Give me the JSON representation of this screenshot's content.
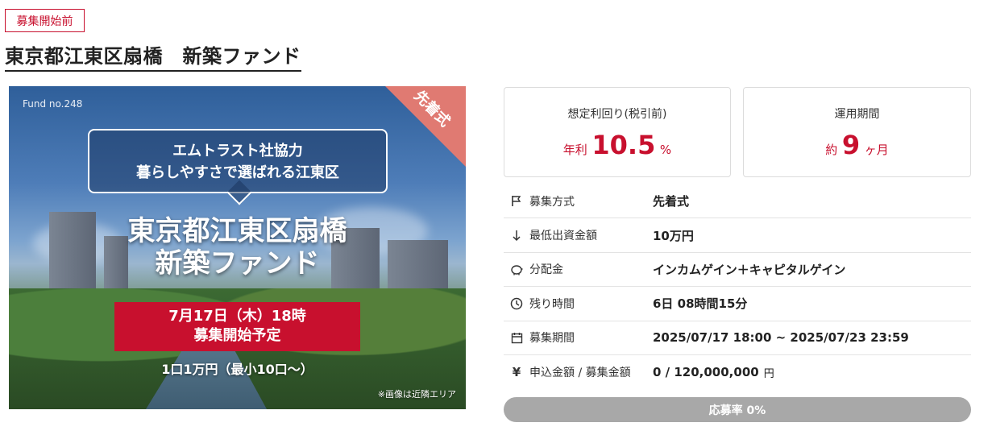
{
  "status_badge": "募集開始前",
  "page_title": "東京都江東区扇橋　新築ファンド",
  "hero": {
    "fund_no": "Fund no.248",
    "corner_tag": "先着式",
    "callout_line1": "エムトラスト社協力",
    "callout_line2": "暮らしやすさで選ばれる江東区",
    "title_line1": "東京都江東区扇橋",
    "title_line2": "新築ファンド",
    "date_line": "7月17日（木）18時",
    "start_line": "募集開始予定",
    "units_line": "1口1万円（最小10口〜）",
    "note": "※画像は近隣エリア"
  },
  "yield_card": {
    "label": "想定利回り(税引前)",
    "prefix": "年利",
    "value": "10.5",
    "suffix": "%"
  },
  "period_card": {
    "label": "運用期間",
    "prefix": "約",
    "value": "9",
    "suffix": "ヶ月"
  },
  "info_rows": [
    {
      "icon": "flag-icon",
      "label": "募集方式",
      "value": "先着式",
      "unit": ""
    },
    {
      "icon": "arrow-down-icon",
      "label": "最低出資金額",
      "value": "10万円",
      "unit": ""
    },
    {
      "icon": "piggy-bank-icon",
      "label": "分配金",
      "value": "インカムゲイン＋キャピタルゲイン",
      "unit": ""
    },
    {
      "icon": "clock-icon",
      "label": "残り時間",
      "value": "6日 08時間15分",
      "unit": ""
    },
    {
      "icon": "calendar-icon",
      "label": "募集期間",
      "value": "2025/07/17 18:00 ~ 2025/07/23 23:59",
      "unit": ""
    },
    {
      "icon": "yen-icon",
      "label": "申込金額 / 募集金額",
      "value": "0 / 120,000,000",
      "unit": "円"
    }
  ],
  "progress": {
    "label": "応募率 0%",
    "percent": 0
  },
  "colors": {
    "accent": "#c8102e",
    "progress_bg": "#a8a8a8"
  }
}
